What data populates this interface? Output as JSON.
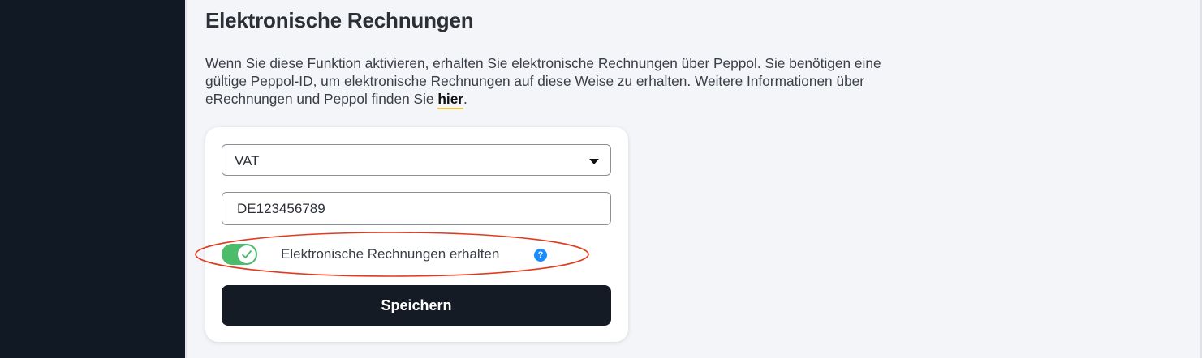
{
  "page": {
    "title": "Elektronische Rechnungen",
    "description_prefix": "Wenn Sie diese Funktion aktivieren, erhalten Sie elektronische Rechnungen über Peppol. Sie benötigen eine gültige Peppol-ID, um elektronische Rechnungen auf diese Weise zu erhalten. Weitere Informationen über eRechnungen und Peppol finden Sie ",
    "description_link": "hier",
    "description_suffix": "."
  },
  "form": {
    "id_type_value": "VAT",
    "id_value": "DE123456789",
    "toggle_label": "Elektronische Rechnungen erhalten",
    "toggle_on": true,
    "help_symbol": "?",
    "save_label": "Speichern"
  },
  "colors": {
    "sidebar": "#111a24",
    "toggle_on": "#4cbb6a",
    "help": "#1a8cff",
    "button": "#151b24",
    "link_underline": "#f0c33c",
    "annotation": "#e23a1f"
  },
  "icons": {
    "dropdown": "caret-down-icon",
    "toggle_check": "check-icon",
    "help": "question-icon"
  }
}
